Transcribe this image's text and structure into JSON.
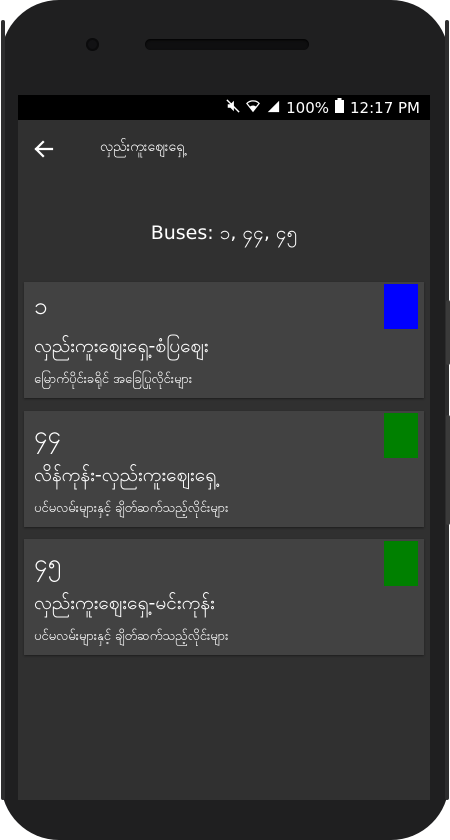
{
  "status_bar": {
    "battery": "100%",
    "time": "12:17 PM",
    "icons": [
      "mute-icon",
      "wifi-icon",
      "signal-icon",
      "battery-icon"
    ]
  },
  "app_bar": {
    "back_icon": "arrow-left-icon",
    "title": "လှည်းကူးဈေးရှေ့"
  },
  "buses_label": "Buses: ၁, ၄၄, ၄၅",
  "routes": [
    {
      "number": "၁",
      "route": "လှည်းကူးဈေးရှေ့-စံပြဈေး",
      "line_type": "မြောက်ပိုင်းခရိုင် အခြေပြုလိုင်းများ",
      "color": "#0000ff"
    },
    {
      "number": "၄၄",
      "route": "လိန်ကုန်း-လှည်းကူးဈေးရှေ့",
      "line_type": "ပင်မလမ်းများနှင့် ချိတ်ဆက်သည့်လိုင်းများ",
      "color": "#008000"
    },
    {
      "number": "၄၅",
      "route": "လှည်းကူးဈေးရှေ့-မင်းကုန်း",
      "line_type": "ပင်မလမ်းများနှင့် ချိတ်ဆက်သည့်လိုင်းများ",
      "color": "#008000"
    }
  ]
}
